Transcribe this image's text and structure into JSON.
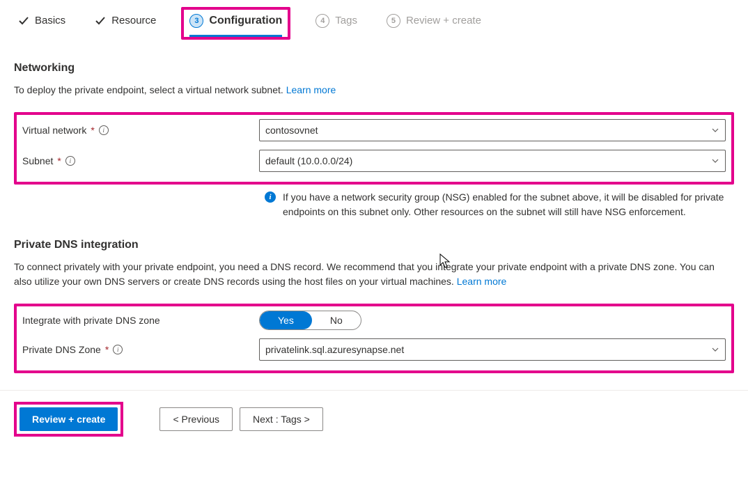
{
  "tabs": {
    "basics": {
      "label": "Basics"
    },
    "resource": {
      "label": "Resource"
    },
    "configuration": {
      "num": "3",
      "label": "Configuration"
    },
    "tags": {
      "num": "4",
      "label": "Tags"
    },
    "review": {
      "num": "5",
      "label": "Review + create"
    }
  },
  "networking": {
    "heading": "Networking",
    "desc": "To deploy the private endpoint, select a virtual network subnet.  ",
    "learn_more": "Learn more",
    "vnet": {
      "label": "Virtual network",
      "value": "contosovnet"
    },
    "subnet": {
      "label": "Subnet",
      "value": "default (10.0.0.0/24)"
    },
    "note": "If you have a network security group (NSG) enabled for the subnet above, it will be disabled for private endpoints on this subnet only. Other resources on the subnet will still have NSG enforcement."
  },
  "dns": {
    "heading": "Private DNS integration",
    "desc": "To connect privately with your private endpoint, you need a DNS record. We recommend that you integrate your private endpoint with a private DNS zone. You can also utilize your own DNS servers or create DNS records using the host files on your virtual machines.  ",
    "learn_more": "Learn more",
    "integrate": {
      "label": "Integrate with private DNS zone",
      "yes": "Yes",
      "no": "No"
    },
    "zone": {
      "label": "Private DNS Zone",
      "value": "privatelink.sql.azuresynapse.net"
    }
  },
  "footer": {
    "review": "Review + create",
    "previous": "< Previous",
    "next": "Next : Tags >"
  }
}
